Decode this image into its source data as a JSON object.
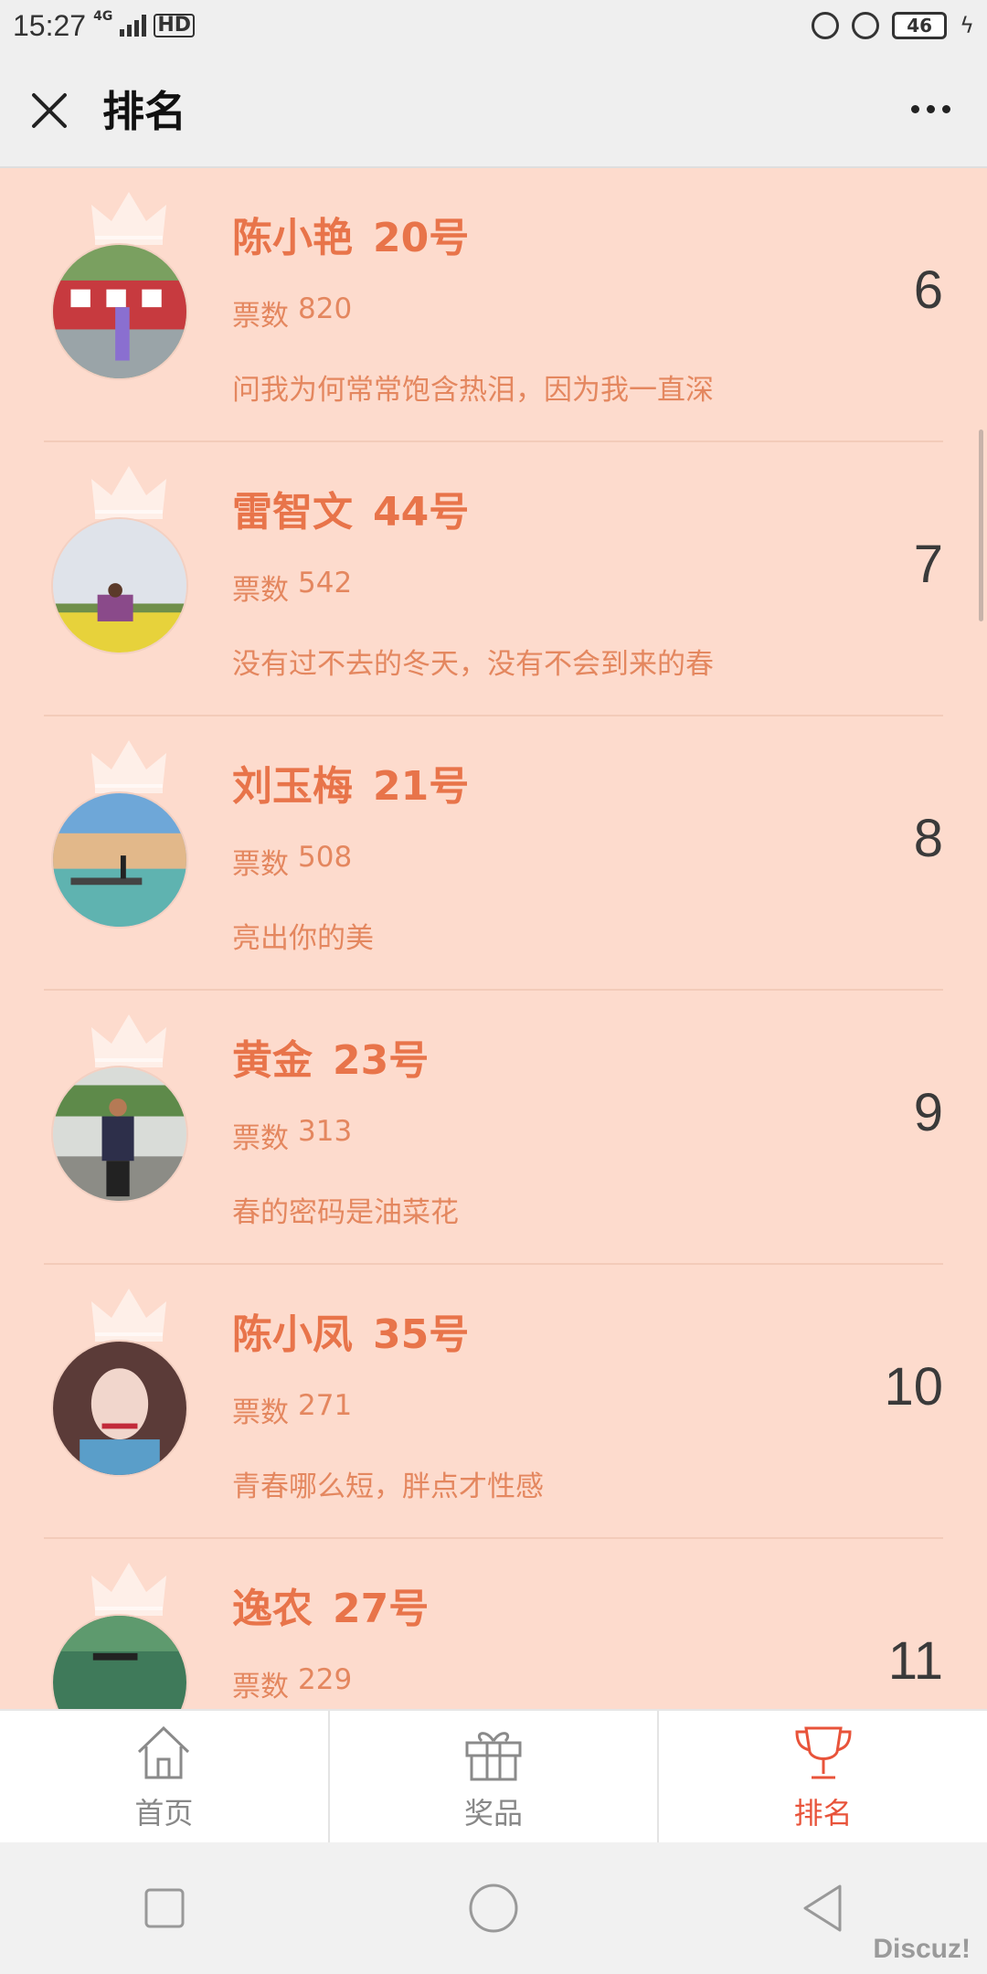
{
  "status_bar": {
    "time": "15:27",
    "network": "4G",
    "hd": "HD",
    "battery": "46"
  },
  "header": {
    "title": "排名"
  },
  "list": [
    {
      "name": "陈小艳",
      "number": "20号",
      "votes_label": "票数",
      "votes": "820",
      "motto": "问我为何常常饱含热泪，因为我一直深",
      "rank": "6"
    },
    {
      "name": "雷智文",
      "number": "44号",
      "votes_label": "票数",
      "votes": "542",
      "motto": "没有过不去的冬天，没有不会到来的春",
      "rank": "7"
    },
    {
      "name": "刘玉梅",
      "number": "21号",
      "votes_label": "票数",
      "votes": "508",
      "motto": "亮出你的美",
      "rank": "8"
    },
    {
      "name": "黄金",
      "number": "23号",
      "votes_label": "票数",
      "votes": "313",
      "motto": "春的密码是油菜花",
      "rank": "9"
    },
    {
      "name": "陈小凤",
      "number": "35号",
      "votes_label": "票数",
      "votes": "271",
      "motto": "青春哪么短，胖点才性感",
      "rank": "10"
    },
    {
      "name": "逸农",
      "number": "27号",
      "votes_label": "票数",
      "votes": "229",
      "motto": "",
      "rank": "11"
    }
  ],
  "tabbar": {
    "tabs": [
      {
        "label": "首页",
        "icon": "home-icon"
      },
      {
        "label": "奖品",
        "icon": "gift-icon"
      },
      {
        "label": "排名",
        "icon": "trophy-icon"
      }
    ],
    "active": 2
  },
  "watermark": "Discuz!",
  "colors": {
    "list_bg": "#fddbcd",
    "name": "#e8744a",
    "secondary": "#e4875f",
    "active_tab": "#e8533a"
  }
}
